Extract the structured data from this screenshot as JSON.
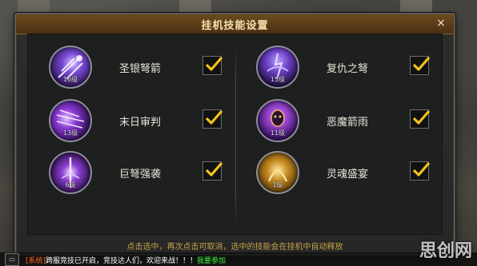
{
  "dialog": {
    "title": "挂机技能设置",
    "close_label": "×",
    "hint": "点击选中，再次点击可取消，选中的技能会在挂机中自动释放"
  },
  "skills": [
    {
      "name": "圣银弩箭",
      "level": "16级",
      "checked": true,
      "icon": "silver-crossbow-bolt-icon",
      "color": "#7a4bd6"
    },
    {
      "name": "复仇之弩",
      "level": "15级",
      "checked": true,
      "icon": "vengeance-crossbow-icon",
      "color": "#6a3fc4"
    },
    {
      "name": "末日审判",
      "level": "13级",
      "checked": true,
      "icon": "doomsday-judgement-icon",
      "color": "#8a3ad6"
    },
    {
      "name": "恶魔箭雨",
      "level": "11级",
      "checked": true,
      "icon": "demon-arrow-rain-icon",
      "color": "#a64ee0"
    },
    {
      "name": "巨弩强袭",
      "level": "6级",
      "checked": true,
      "icon": "giant-crossbow-assault-icon",
      "color": "#8c3fd0"
    },
    {
      "name": "灵魂盛宴",
      "level": "1级",
      "checked": true,
      "icon": "soul-feast-icon",
      "color": "#c58a20"
    }
  ],
  "chat": {
    "system_tag": "[系统]",
    "message": "跨服竞技已开启，竞技达人们，欢迎来战！！！",
    "link": "我要参加",
    "toggle": "▭"
  },
  "watermark": "思创网"
}
